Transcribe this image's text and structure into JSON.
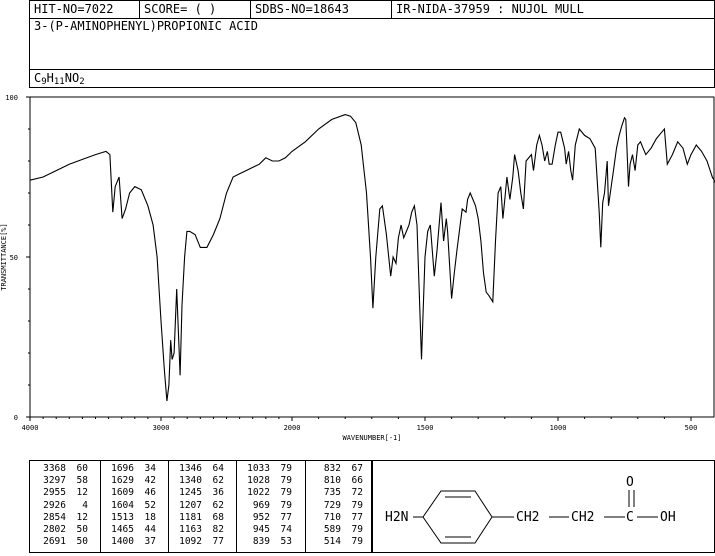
{
  "header": {
    "hit_no": "HIT-NO=7022",
    "score": "SCORE=  (   )",
    "sdbs_no": "SDBS-NO=18643",
    "ir_info": "IR-NIDA-37959 : NUJOL MULL"
  },
  "compound": {
    "name": "3-(P-AMINOPHENYL)PROPIONIC ACID",
    "formula_parts": [
      {
        "t": "C",
        "sub": false
      },
      {
        "t": "9",
        "sub": true
      },
      {
        "t": "H",
        "sub": false
      },
      {
        "t": "11",
        "sub": true
      },
      {
        "t": "N",
        "sub": false
      },
      {
        "t": "O",
        "sub": false
      },
      {
        "t": "2",
        "sub": true
      }
    ]
  },
  "chart_data": {
    "type": "line",
    "xlabel": "WAVENUMBER[-1]",
    "ylabel": "TRANSMITTANCE[%]",
    "xlim": [
      4000,
      400
    ],
    "ylim": [
      0,
      100
    ],
    "x_ticks": [
      4000,
      3000,
      2000,
      1500,
      1000,
      500
    ],
    "y_ticks": [
      0,
      50,
      100
    ],
    "series": [
      {
        "points": [
          [
            4000,
            74
          ],
          [
            3900,
            75
          ],
          [
            3800,
            77
          ],
          [
            3700,
            79
          ],
          [
            3600,
            80.5
          ],
          [
            3500,
            82
          ],
          [
            3420,
            83
          ],
          [
            3390,
            82
          ],
          [
            3368,
            64
          ],
          [
            3350,
            72
          ],
          [
            3320,
            75
          ],
          [
            3297,
            62
          ],
          [
            3270,
            65
          ],
          [
            3240,
            70
          ],
          [
            3200,
            72
          ],
          [
            3150,
            71
          ],
          [
            3100,
            66
          ],
          [
            3060,
            60
          ],
          [
            3030,
            50
          ],
          [
            3000,
            30
          ],
          [
            2975,
            15
          ],
          [
            2955,
            5
          ],
          [
            2940,
            10
          ],
          [
            2926,
            24
          ],
          [
            2915,
            18
          ],
          [
            2900,
            20
          ],
          [
            2880,
            40
          ],
          [
            2854,
            13
          ],
          [
            2840,
            35
          ],
          [
            2820,
            50
          ],
          [
            2802,
            58
          ],
          [
            2780,
            58
          ],
          [
            2740,
            57
          ],
          [
            2700,
            53
          ],
          [
            2691,
            53
          ],
          [
            2650,
            53
          ],
          [
            2600,
            57
          ],
          [
            2550,
            62
          ],
          [
            2500,
            70
          ],
          [
            2450,
            75
          ],
          [
            2400,
            76
          ],
          [
            2350,
            77
          ],
          [
            2300,
            78
          ],
          [
            2250,
            79
          ],
          [
            2200,
            81
          ],
          [
            2150,
            80
          ],
          [
            2100,
            80
          ],
          [
            2050,
            81
          ],
          [
            2000,
            83
          ],
          [
            1950,
            86
          ],
          [
            1900,
            90
          ],
          [
            1850,
            93
          ],
          [
            1800,
            94.5
          ],
          [
            1780,
            94
          ],
          [
            1760,
            92
          ],
          [
            1740,
            85
          ],
          [
            1720,
            70
          ],
          [
            1705,
            50
          ],
          [
            1696,
            34
          ],
          [
            1685,
            50
          ],
          [
            1670,
            65
          ],
          [
            1660,
            66
          ],
          [
            1645,
            57
          ],
          [
            1629,
            44
          ],
          [
            1620,
            50
          ],
          [
            1609,
            48
          ],
          [
            1600,
            56
          ],
          [
            1590,
            60
          ],
          [
            1580,
            56
          ],
          [
            1570,
            58
          ],
          [
            1560,
            60
          ],
          [
            1550,
            64
          ],
          [
            1540,
            66
          ],
          [
            1530,
            60
          ],
          [
            1513,
            18
          ],
          [
            1500,
            50
          ],
          [
            1490,
            58
          ],
          [
            1480,
            60
          ],
          [
            1465,
            44
          ],
          [
            1455,
            52
          ],
          [
            1440,
            67
          ],
          [
            1430,
            55
          ],
          [
            1420,
            62
          ],
          [
            1415,
            58
          ],
          [
            1400,
            37
          ],
          [
            1390,
            45
          ],
          [
            1380,
            52
          ],
          [
            1360,
            65
          ],
          [
            1346,
            64
          ],
          [
            1340,
            68
          ],
          [
            1330,
            70
          ],
          [
            1320,
            68
          ],
          [
            1310,
            66
          ],
          [
            1300,
            62
          ],
          [
            1290,
            55
          ],
          [
            1280,
            45
          ],
          [
            1270,
            39
          ],
          [
            1260,
            38
          ],
          [
            1245,
            36
          ],
          [
            1235,
            55
          ],
          [
            1225,
            70
          ],
          [
            1215,
            72
          ],
          [
            1207,
            62
          ],
          [
            1200,
            68
          ],
          [
            1192,
            75
          ],
          [
            1181,
            68
          ],
          [
            1170,
            75
          ],
          [
            1163,
            82
          ],
          [
            1150,
            77
          ],
          [
            1140,
            70
          ],
          [
            1130,
            65
          ],
          [
            1120,
            80
          ],
          [
            1100,
            82
          ],
          [
            1092,
            77
          ],
          [
            1080,
            85
          ],
          [
            1070,
            88
          ],
          [
            1060,
            85
          ],
          [
            1050,
            80
          ],
          [
            1040,
            83
          ],
          [
            1033,
            79
          ],
          [
            1028,
            79
          ],
          [
            1022,
            79
          ],
          [
            1010,
            85
          ],
          [
            1000,
            89
          ],
          [
            990,
            89
          ],
          [
            975,
            84
          ],
          [
            969,
            79
          ],
          [
            960,
            83
          ],
          [
            952,
            77
          ],
          [
            945,
            74
          ],
          [
            935,
            85
          ],
          [
            920,
            90
          ],
          [
            900,
            88
          ],
          [
            880,
            87
          ],
          [
            860,
            84
          ],
          [
            845,
            64
          ],
          [
            839,
            53
          ],
          [
            832,
            67
          ],
          [
            825,
            70
          ],
          [
            815,
            80
          ],
          [
            810,
            66
          ],
          [
            800,
            72
          ],
          [
            790,
            78
          ],
          [
            780,
            84
          ],
          [
            770,
            88
          ],
          [
            760,
            91
          ],
          [
            750,
            93.5
          ],
          [
            745,
            93
          ],
          [
            735,
            72
          ],
          [
            729,
            79
          ],
          [
            720,
            82
          ],
          [
            716,
            80
          ],
          [
            710,
            77
          ],
          [
            700,
            85
          ],
          [
            690,
            86
          ],
          [
            680,
            84
          ],
          [
            670,
            82
          ],
          [
            650,
            84
          ],
          [
            630,
            87
          ],
          [
            610,
            89
          ],
          [
            600,
            90
          ],
          [
            589,
            79
          ],
          [
            570,
            82
          ],
          [
            550,
            86
          ],
          [
            530,
            84
          ],
          [
            514,
            79
          ],
          [
            500,
            82
          ],
          [
            480,
            85
          ],
          [
            460,
            83
          ],
          [
            440,
            80
          ],
          [
            420,
            75
          ],
          [
            400,
            72
          ]
        ]
      }
    ]
  },
  "peaks": [
    [
      [
        3368,
        60
      ],
      [
        3297,
        58
      ],
      [
        2955,
        12
      ],
      [
        2926,
        4
      ],
      [
        2854,
        12
      ],
      [
        2802,
        50
      ],
      [
        2691,
        50
      ]
    ],
    [
      [
        1696,
        34
      ],
      [
        1629,
        42
      ],
      [
        1609,
        46
      ],
      [
        1604,
        52
      ],
      [
        1513,
        18
      ],
      [
        1465,
        44
      ],
      [
        1400,
        37
      ]
    ],
    [
      [
        1346,
        64
      ],
      [
        1340,
        62
      ],
      [
        1245,
        36
      ],
      [
        1207,
        62
      ],
      [
        1181,
        68
      ],
      [
        1163,
        82
      ],
      [
        1092,
        77
      ]
    ],
    [
      [
        1033,
        79
      ],
      [
        1028,
        79
      ],
      [
        1022,
        79
      ],
      [
        969,
        79
      ],
      [
        952,
        77
      ],
      [
        945,
        74
      ],
      [
        839,
        53
      ]
    ],
    [
      [
        832,
        67
      ],
      [
        810,
        66
      ],
      [
        735,
        72
      ],
      [
        729,
        79
      ],
      [
        710,
        77
      ],
      [
        589,
        79
      ],
      [
        514,
        79
      ]
    ]
  ],
  "structure": {
    "left_group": "H2N",
    "chain_1": "CH2",
    "chain_2": "CH2",
    "carbonyl_c": "C",
    "oxygen_top": "O",
    "hydroxyl": "OH"
  }
}
